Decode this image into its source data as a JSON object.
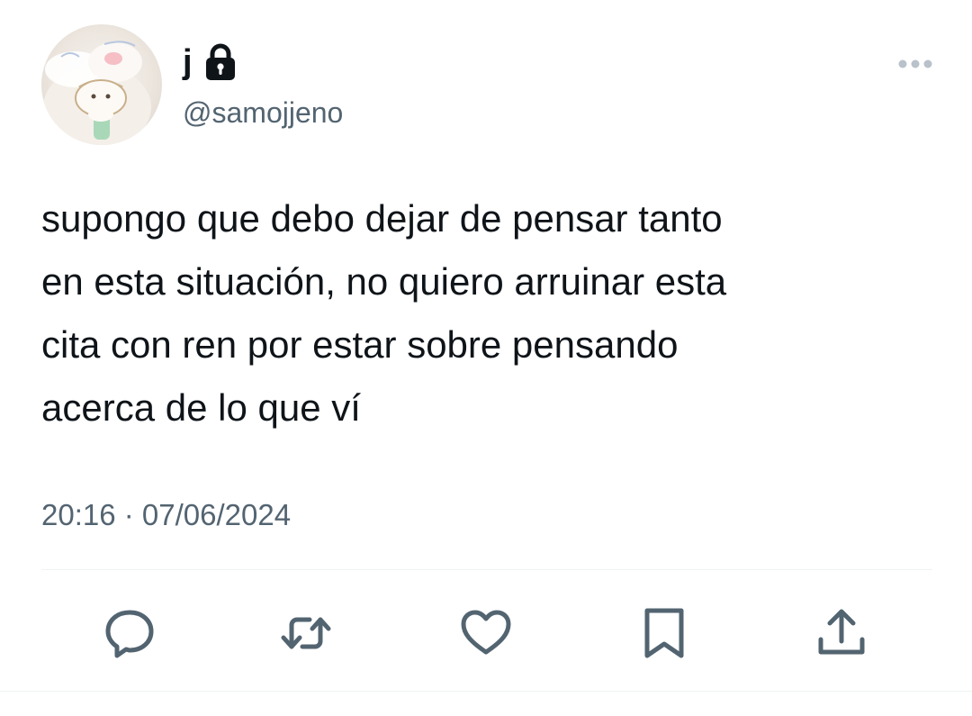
{
  "user": {
    "display_name": "j",
    "handle": "@samojjeno",
    "verified_protected_icon": "lock-icon",
    "avatar_icon": "plush-toy-avatar"
  },
  "tweet": {
    "text": "supongo que debo dejar de pensar tanto\nen esta situación, no quiero arruinar esta\ncita con ren por estar sobre pensando\nacerca de lo que ví",
    "timestamp": "20:16 · 07/06/2024"
  },
  "actions": [
    {
      "name": "reply",
      "icon": "reply-bubble-icon"
    },
    {
      "name": "retweet",
      "icon": "retweet-icon"
    },
    {
      "name": "like",
      "icon": "heart-icon"
    },
    {
      "name": "bookmark",
      "icon": "bookmark-icon"
    },
    {
      "name": "share",
      "icon": "share-icon"
    }
  ],
  "colors": {
    "text": "#0f1419",
    "secondary": "#536471",
    "divider": "#eff3f4",
    "icon": "#536471"
  }
}
